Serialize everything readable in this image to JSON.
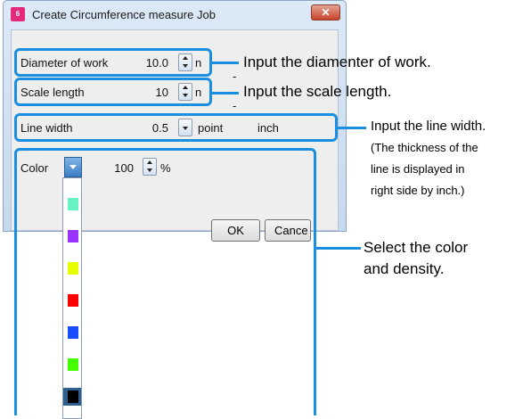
{
  "window": {
    "title": "Create Circumference measure Job",
    "app_icon_text": "6",
    "close_glyph": "✕"
  },
  "fields": {
    "diameter": {
      "label": "Diameter of work",
      "value": "10.0",
      "unit": "n",
      "trail": "--"
    },
    "scale": {
      "label": "Scale length",
      "value": "10",
      "unit": "n",
      "trail": "--"
    },
    "line_width": {
      "label": "Line width",
      "value": "0.5",
      "unit": "point",
      "inch_label": "inch"
    },
    "color": {
      "label": "Color",
      "density": "100",
      "unit": "%"
    }
  },
  "buttons": {
    "ok": "OK",
    "cancel": "Cance"
  },
  "color_options": [
    "#66f2c2",
    "#9933ff",
    "#e6ff00",
    "#ff0000",
    "#1a4dff",
    "#44ff00",
    "#000000"
  ],
  "annotations": {
    "diameter": "Input the diamenter of work.",
    "scale": "Input the scale length.",
    "line_width": [
      "Input the line width.",
      "(The thickness of the",
      "line is displayed in",
      "right side by inch.)"
    ],
    "color": [
      "Select the color",
      "and density."
    ]
  },
  "colors": {
    "accent": "#1a8fe0",
    "dialog_bg": "#eeeeee"
  }
}
